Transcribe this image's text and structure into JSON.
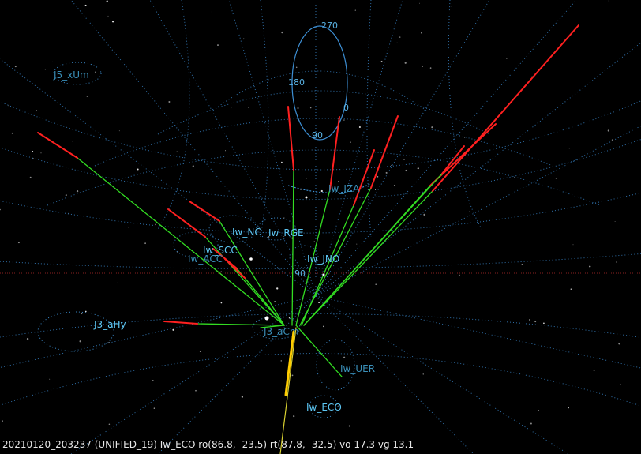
{
  "status_line": "20210120_203237 (UNIFIED_19) Iw_ECO ro(86.8, -23.5) rt(87.8, -32.5) vo 17.3 vg 13.1",
  "stations": {
    "j5_xum": "J5_xUm",
    "iw_jza": "Iw_JZA",
    "iw_nc": "Iw_NC",
    "iw_rge": "Iw_RGE",
    "iw_scc": "Iw_SCC",
    "iw_acc": "Iw_ACC",
    "iw_jno": "Iw_JNO",
    "j3_ahy": "J3_aHy",
    "j3_acm": "J3_aCm",
    "iw_uer": "Iw_UER",
    "iw_eco": "Iw_ECO"
  },
  "azimuth_labels": {
    "a270": "270",
    "a180": "180",
    "a0": "0",
    "a90": "90",
    "alt90": "90"
  },
  "colors": {
    "background": "#000000",
    "grid": "#2f6fa8",
    "label": "#4fb8e8",
    "meteor_head": "#ff2020",
    "meteor_trail": "#33dd22",
    "meteor_core": "#ffcc00",
    "status_text": "#e6e6e6"
  }
}
